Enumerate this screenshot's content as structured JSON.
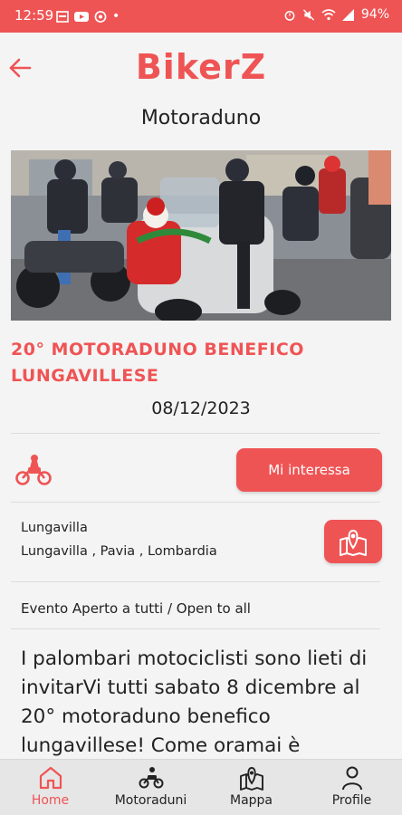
{
  "status_bar": {
    "time": "12:59",
    "battery": "94%",
    "dot": "•",
    "left_icons": [
      "calendar-icon",
      "youtube-icon",
      "chrome-icon"
    ],
    "right_icons": [
      "alarm-icon",
      "mute-icon",
      "wifi-icon",
      "signal-icon"
    ]
  },
  "app": {
    "logo": "BikerZ",
    "brand_color": "#ef5455"
  },
  "page": {
    "title": "Motoraduno"
  },
  "event": {
    "title_line1": "20° MOTORADUNO BENEFICO",
    "title_line2": "LUNGAVILLESE",
    "date": "08/12/2023",
    "interest_button": "Mi interessa",
    "location_name": "Lungavilla",
    "location_detail": "Lungavilla , Pavia , Lombardia",
    "access": "Evento Aperto a tutti / Open to all",
    "description": "I palombari motociclisti sono lieti di invitarVi tutti sabato 8 dicembre al 20° motoraduno benefico lungavillese! Come oramai è"
  },
  "bottom_nav": {
    "items": [
      {
        "label": "Home",
        "icon": "home-icon",
        "active": true
      },
      {
        "label": "Motoraduni",
        "icon": "motorbike-icon",
        "active": false
      },
      {
        "label": "Mappa",
        "icon": "map-icon",
        "active": false
      },
      {
        "label": "Profile",
        "icon": "profile-icon",
        "active": false
      }
    ]
  }
}
